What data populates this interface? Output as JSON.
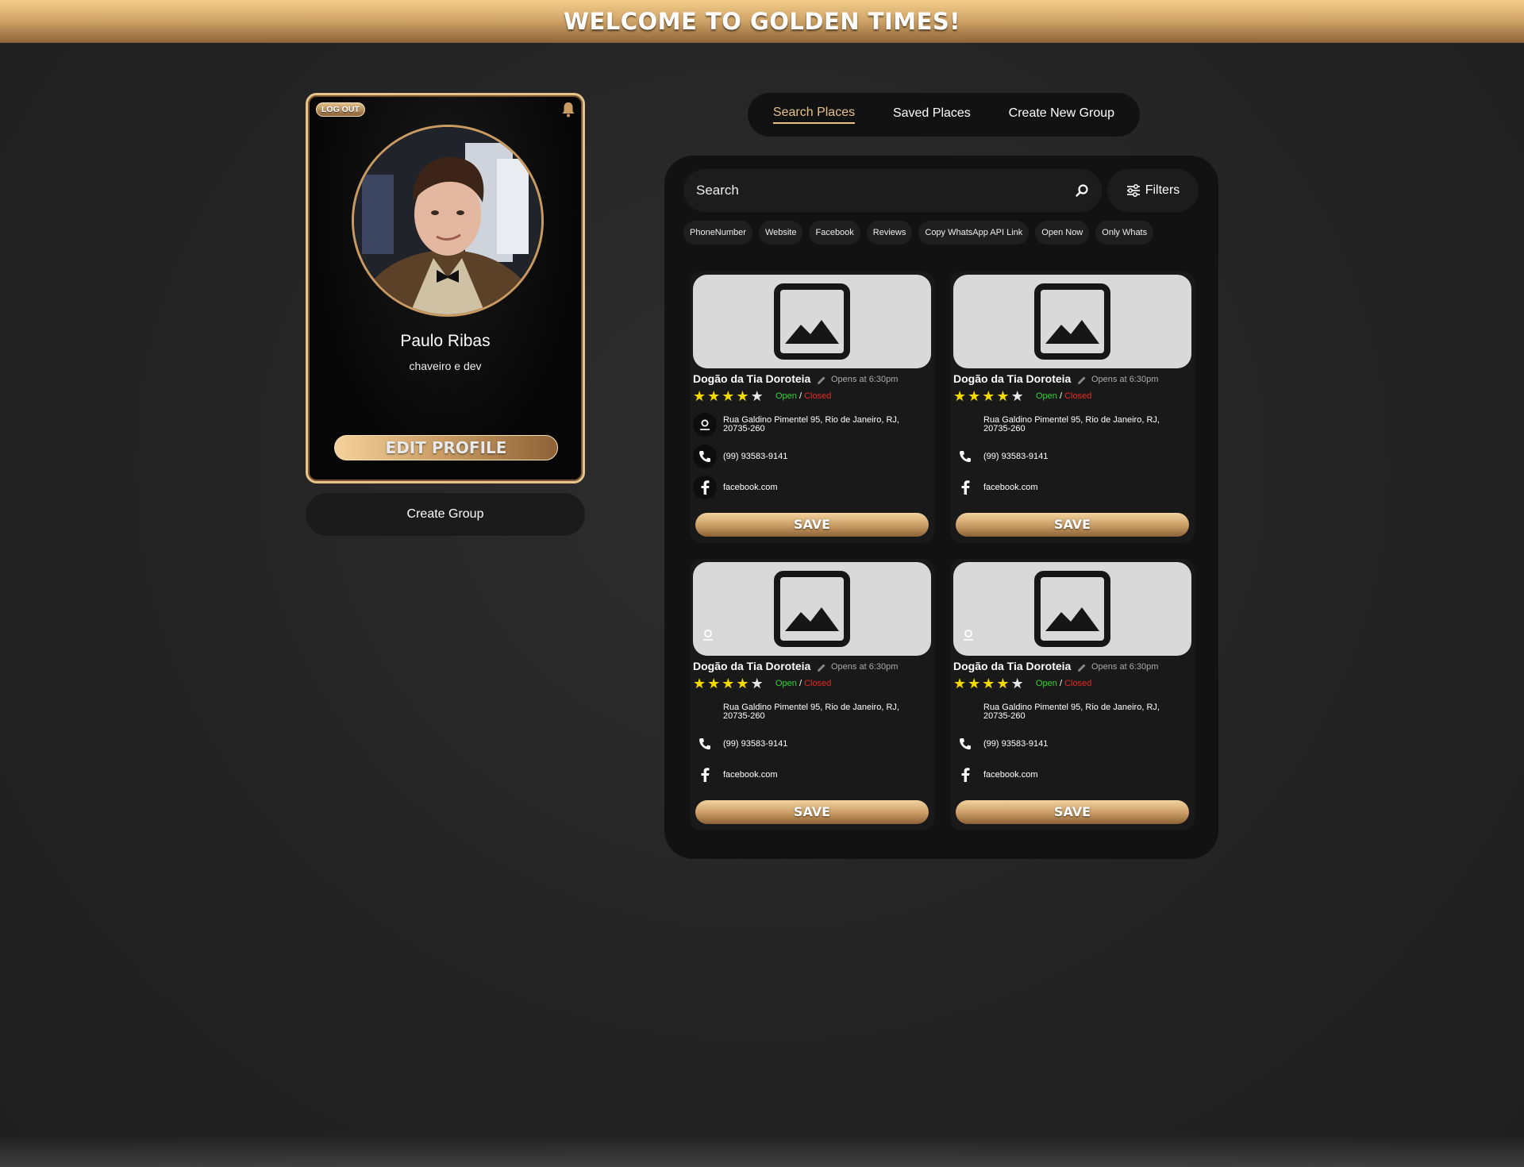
{
  "header": {
    "title": "WELCOME TO GOLDEN TIMES!"
  },
  "profile": {
    "logout_label": "LOG OUT",
    "name": "Paulo Ribas",
    "bio": "chaveiro e dev",
    "edit_label": "EDIT PROFILE"
  },
  "sidebar": {
    "create_group_label": "Create Group"
  },
  "tabs": [
    {
      "label": "Search Places",
      "active": true
    },
    {
      "label": "Saved Places",
      "active": false
    },
    {
      "label": "Create New Group",
      "active": false
    }
  ],
  "search": {
    "placeholder": "Search",
    "filters_label": "Filters"
  },
  "chips": [
    "PhoneNumber",
    "Website",
    "Facebook",
    "Reviews",
    "Copy WhatsApp API Link",
    "Open Now",
    "Only Whats"
  ],
  "places": [
    {
      "name": "Dogão da Tia Doroteia",
      "opens": "Opens at 6:30pm",
      "rating": 4,
      "rating_max": 5,
      "open_label": "Open",
      "closed_label": "Closed",
      "address": "Rua Galdino Pimentel 95, Rio de Janeiro, RJ,",
      "address2": "20735-260",
      "phone": "(99) 93583-9141",
      "facebook": "facebook.com",
      "save_label": "SAVE"
    },
    {
      "name": "Dogão da Tia Doroteia",
      "opens": "Opens at 6:30pm",
      "rating": 4,
      "rating_max": 5,
      "open_label": "Open",
      "closed_label": "Closed",
      "address": "Rua Galdino Pimentel 95, Rio de Janeiro, RJ,",
      "address2": "20735-260",
      "phone": "(99) 93583-9141",
      "facebook": "facebook.com",
      "save_label": "SAVE"
    },
    {
      "name": "Dogão da Tia Doroteia",
      "opens": "Opens at 6:30pm",
      "rating": 4,
      "rating_max": 5,
      "open_label": "Open",
      "closed_label": "Closed",
      "address": "Rua Galdino Pimentel 95, Rio de Janeiro, RJ,",
      "address2": "20735-260",
      "phone": "(99) 93583-9141",
      "facebook": "facebook.com",
      "save_label": "SAVE"
    },
    {
      "name": "Dogão da Tia Doroteia",
      "opens": "Opens at 6:30pm",
      "rating": 4,
      "rating_max": 5,
      "open_label": "Open",
      "closed_label": "Closed",
      "address": "Rua Galdino Pimentel 95, Rio de Janeiro, RJ,",
      "address2": "20735-260",
      "phone": "(99) 93583-9141",
      "facebook": "facebook.com",
      "save_label": "SAVE"
    }
  ],
  "icons": {
    "bell": "bell-icon",
    "search": "search-icon",
    "filters": "sliders-icon",
    "image": "image-placeholder-icon",
    "pin": "map-pin-icon",
    "phone": "phone-icon",
    "facebook": "facebook-icon",
    "edit": "pencil-icon",
    "star": "star-icon"
  },
  "colors": {
    "accent": "#e8c088",
    "gold_light": "#f3cd8a",
    "gold_dark": "#8e6538",
    "open": "#33d433",
    "closed": "#e8281e",
    "star": "#f4d900",
    "panel": "#121212"
  }
}
